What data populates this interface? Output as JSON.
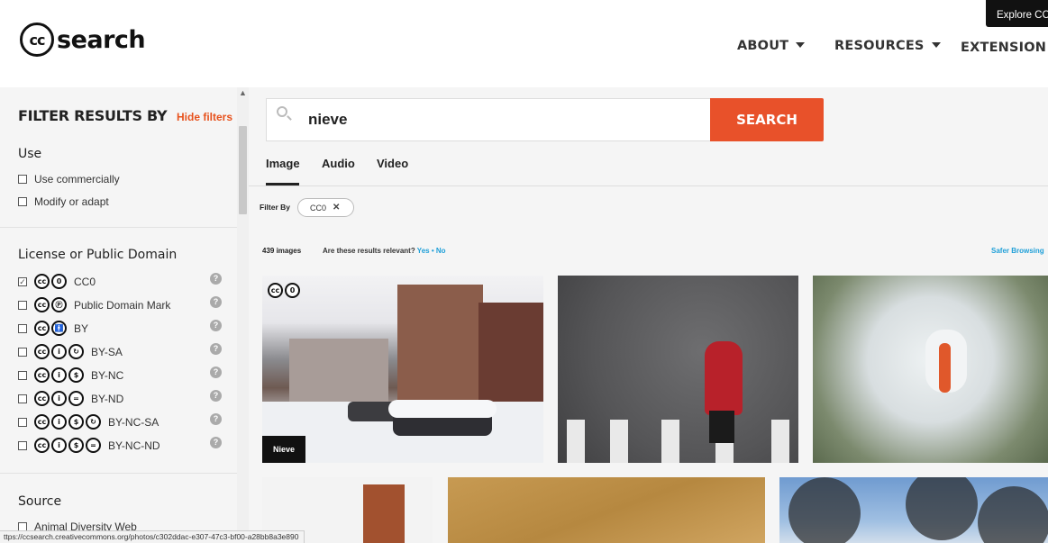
{
  "header": {
    "logo_text": "search",
    "logo_cc": "cc",
    "nav": [
      {
        "label": "ABOUT",
        "has_dropdown": true
      },
      {
        "label": "RESOURCES",
        "has_dropdown": true
      },
      {
        "label": "EXTENSION",
        "external": true
      }
    ],
    "explore_label": "Explore CC"
  },
  "sidebar": {
    "title": "FILTER RESULTS BY",
    "hide_filters": "Hide filters",
    "use": {
      "title": "Use",
      "options": [
        {
          "label": "Use commercially",
          "checked": false
        },
        {
          "label": "Modify or adapt",
          "checked": false
        }
      ]
    },
    "license": {
      "title": "License or Public Domain",
      "options": [
        {
          "label": "CC0",
          "checked": true,
          "icons": [
            "cc-icon",
            "zero-icon"
          ]
        },
        {
          "label": "Public Domain Mark",
          "checked": false,
          "icons": [
            "cc-icon",
            "pd-icon"
          ]
        },
        {
          "label": "BY",
          "checked": false,
          "icons": [
            "cc-icon",
            "by-icon"
          ]
        },
        {
          "label": "BY-SA",
          "checked": false,
          "icons": [
            "cc-icon",
            "by-icon",
            "sa-icon"
          ]
        },
        {
          "label": "BY-NC",
          "checked": false,
          "icons": [
            "cc-icon",
            "by-icon",
            "nc-icon"
          ]
        },
        {
          "label": "BY-ND",
          "checked": false,
          "icons": [
            "cc-icon",
            "by-icon",
            "nd-icon"
          ]
        },
        {
          "label": "BY-NC-SA",
          "checked": false,
          "icons": [
            "cc-icon",
            "by-icon",
            "nc-icon",
            "sa-icon"
          ]
        },
        {
          "label": "BY-NC-ND",
          "checked": false,
          "icons": [
            "cc-icon",
            "by-icon",
            "nc-icon",
            "nd-icon"
          ]
        }
      ],
      "help_glyph": "?"
    },
    "source": {
      "title": "Source",
      "options": [
        {
          "label": "Animal Diversity Web",
          "checked": false
        }
      ]
    }
  },
  "search": {
    "query": "nieve",
    "button_label": "SEARCH"
  },
  "tabs": [
    {
      "label": "Image",
      "active": true
    },
    {
      "label": "Audio",
      "active": false
    },
    {
      "label": "Video",
      "active": false
    }
  ],
  "filter_bar": {
    "label": "Filter By",
    "chip": "CC0",
    "chip_close": "✕"
  },
  "results": {
    "count": "439 images",
    "question": "Are these results relevant?",
    "yes": "Yes",
    "separator": "•",
    "no": "No",
    "safer_browsing": "Safer Browsing"
  },
  "images": [
    {
      "caption": "Nieve",
      "license_badge": [
        "cc-icon",
        "zero-icon"
      ]
    },
    {
      "caption": ""
    },
    {
      "caption": ""
    },
    {
      "caption": ""
    },
    {
      "caption": ""
    },
    {
      "caption": ""
    }
  ],
  "status_url": "ttps://ccsearch.creativecommons.org/photos/c302ddac-e307-47c3-bf00-a28bb8a3e890",
  "colors": {
    "accent": "#e8512a",
    "link": "#1e9fd8",
    "panel_bg": "#f5f5f5"
  }
}
